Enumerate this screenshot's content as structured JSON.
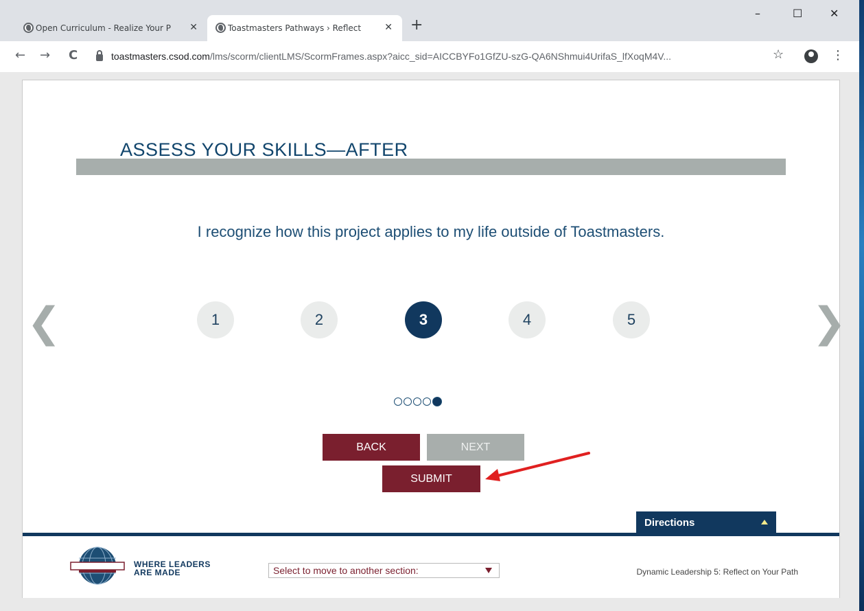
{
  "browser": {
    "tabs": [
      {
        "title": "Open Curriculum - Realize Your P",
        "active": false
      },
      {
        "title": "Toastmasters Pathways › Reflect",
        "active": true
      }
    ],
    "new_tab": "+",
    "window_controls": {
      "minimize": "–",
      "maximize": "☐",
      "close": "✕"
    },
    "nav": {
      "back": "←",
      "forward": "→",
      "reload": "C"
    },
    "url_host": "toastmasters.csod.com",
    "url_path": "/lms/scorm/clientLMS/ScormFrames.aspx?aicc_sid=AICCBYFo1GfZU-szG-QA6NShmui4UrifaS_lfXoqM4V...",
    "star": "☆",
    "menu": "⋮"
  },
  "lesson": {
    "heading": "ASSESS YOUR SKILLS—AFTER",
    "statement": "I recognize how this project applies to my life outside of Toastmasters.",
    "prev_arrow": "❮",
    "next_arrow": "❯",
    "ratings": [
      "1",
      "2",
      "3",
      "4",
      "5"
    ],
    "selected_rating": "3",
    "progress": {
      "total": 5,
      "current": 5
    }
  },
  "buttons": {
    "back": "BACK",
    "next": "NEXT",
    "submit": "SUBMIT"
  },
  "directions": {
    "label": "Directions"
  },
  "footer": {
    "tagline_line1": "WHERE LEADERS",
    "tagline_line2": "ARE MADE",
    "section_select": "Select to move to another section:",
    "course_name": "Dynamic Leadership 5: Reflect on Your Path"
  },
  "colors": {
    "primary_navy": "#11385e",
    "maroon": "#7a1f2e",
    "gray_button": "#a8aeac",
    "annotation_red": "#e02020"
  }
}
